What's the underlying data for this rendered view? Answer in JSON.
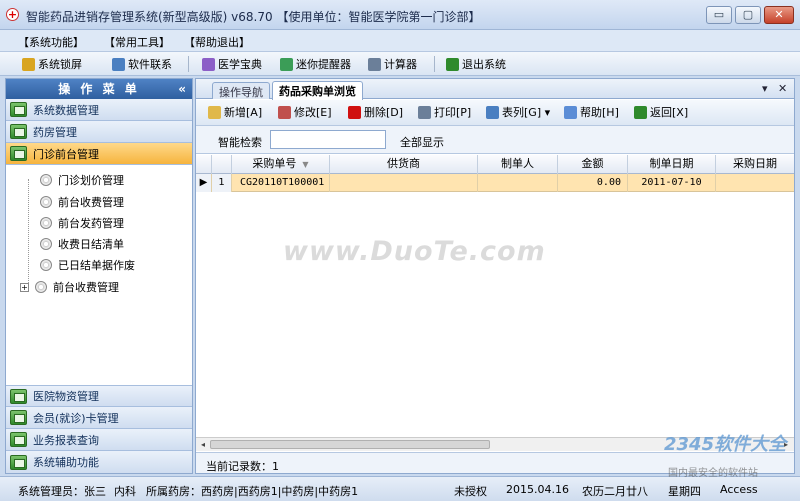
{
  "window": {
    "title": "智能药品进销存管理系统(新型高级版) v68.70  【使用单位：智能医学院第一门诊部】",
    "controls": {
      "minimize": "▭",
      "maximize": "▢",
      "close": "✕"
    }
  },
  "menu": [
    "【系统功能】",
    "【常用工具】",
    "【帮助退出】"
  ],
  "toolbar": [
    {
      "label": "系统锁屏",
      "icon": "lock-icon",
      "color": "#d9a520"
    },
    {
      "label": "软件联系",
      "icon": "people-icon",
      "color": "#4a7fc1"
    },
    {
      "label": "医学宝典",
      "icon": "book-icon",
      "color": "#8c5fc7"
    },
    {
      "label": "迷你提醒器",
      "icon": "bell-icon",
      "color": "#3b9d57"
    },
    {
      "label": "计算器",
      "icon": "calculator-icon",
      "color": "#6b7f99"
    },
    {
      "label": "退出系统",
      "icon": "exit-icon",
      "color": "#2f8a2c"
    }
  ],
  "sidebar": {
    "title": "操 作 菜 单",
    "collapse": "«",
    "groups_top": [
      "系统数据管理",
      "药房管理",
      "门诊前台管理"
    ],
    "tree": [
      "门诊划价管理",
      "前台收费管理",
      "前台发药管理",
      "收费日结清单",
      "已日结单据作废",
      "前台收费管理"
    ],
    "tree_expand": "+",
    "groups_bottom": [
      "医院物资管理",
      "会员(就诊)卡管理",
      "业务报表查询",
      "系统辅助功能"
    ]
  },
  "tabs": [
    {
      "label": "操作导航",
      "active": false
    },
    {
      "label": "药品采购单浏览",
      "active": true
    }
  ],
  "tab_controls": {
    "menu": "▾",
    "close": "✕"
  },
  "actions": [
    {
      "label": "新增[A]",
      "icon": "new-icon",
      "color": "#e0b84a"
    },
    {
      "label": "修改[E]",
      "icon": "edit-icon",
      "color": "#c0504d"
    },
    {
      "label": "删除[D]",
      "icon": "delete-icon",
      "color": "#d01010"
    },
    {
      "label": "打印[P]",
      "icon": "print-icon",
      "color": "#6b7f99"
    },
    {
      "label": "表列[G] ▾",
      "icon": "columns-icon",
      "color": "#4a7fc1"
    },
    {
      "label": "帮助[H]",
      "icon": "help-icon",
      "color": "#5b8dd6"
    },
    {
      "label": "返回[X]",
      "icon": "return-icon",
      "color": "#2f8a2c"
    }
  ],
  "search": {
    "label": "智能检索",
    "value": "",
    "show_all": "全部显示"
  },
  "grid": {
    "columns": [
      "采购单号",
      "供货商",
      "制单人",
      "金额",
      "制单日期",
      "采购日期"
    ],
    "sort_indicator": "▼",
    "rows": [
      {
        "indicator": "▶",
        "num": "1",
        "cells": [
          "CG20110T100001",
          "",
          "",
          "0.00",
          "2011-07-10",
          ""
        ]
      }
    ]
  },
  "scroll": {
    "left": "◂",
    "right": "▸"
  },
  "record_count": "当前记录数：1",
  "status": {
    "operator": "系统管理员：张三",
    "dept": "内科",
    "pharmacy": "所属药房：西药房|西药房1|中药房|中药房1",
    "license": "未授权",
    "date": "2015.04.16",
    "lunar": "农历二月廿八",
    "weekday": "星期四",
    "db": "Access"
  },
  "watermark": "www.DuoTe.com",
  "badge": {
    "logo": "2345软件大全",
    "sub": "国内最安全的软件站"
  }
}
